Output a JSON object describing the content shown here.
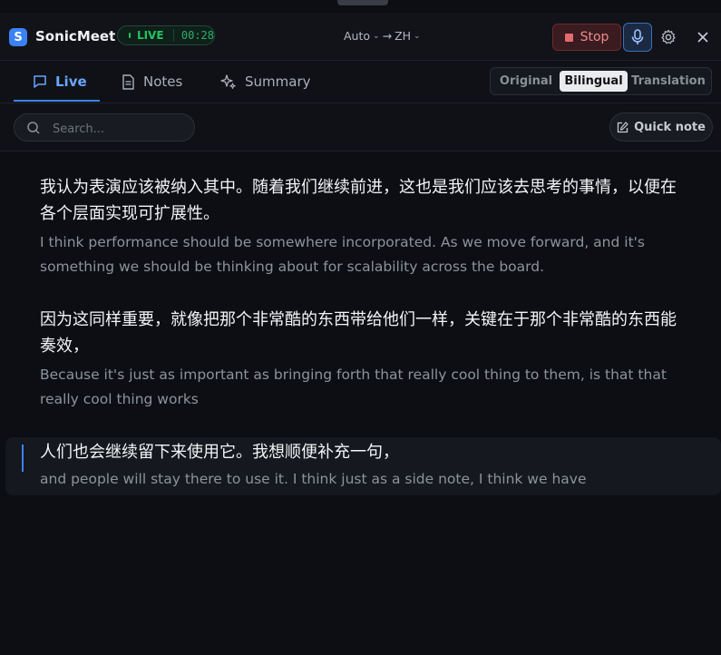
{
  "app": {
    "name": "SonicMeet",
    "logo_letter": "S",
    "live_label": "LIVE",
    "elapsed": "00:28",
    "source_lang": "Auto",
    "arrow": "→",
    "target_lang": "ZH",
    "stop_label": "Stop"
  },
  "tabs": [
    {
      "label": "Live",
      "icon": "chat-bubble-icon",
      "active": true
    },
    {
      "label": "Notes",
      "icon": "document-icon",
      "active": false
    },
    {
      "label": "Summary",
      "icon": "sparkles-icon",
      "active": false
    }
  ],
  "view_modes": [
    {
      "label": "Original",
      "active": false
    },
    {
      "label": "Bilingual",
      "active": true
    },
    {
      "label": "Translation",
      "active": false
    }
  ],
  "search": {
    "placeholder": "Search..."
  },
  "quick_note_label": "Quick note",
  "transcript": [
    {
      "zh": "我认为表演应该被纳入其中。随着我们继续前进，这也是我们应该去思考的事情，以便在各个层面实现可扩展性。",
      "en": "I think performance should be somewhere incorporated. As we move forward, and it's something we should be thinking about for scalability across the board."
    },
    {
      "zh": "因为这同样重要，就像把那个非常酷的东西带给他们一样，关键在于那个非常酷的东西能奏效，",
      "en": "Because it's just as important as bringing forth that really cool thing to them, is that that really cool thing works"
    },
    {
      "zh": "人们也会继续留下来使用它。我想顺便补充一句，",
      "en": "and people will stay there to use it. I think just as a side note, I think we have",
      "current": true
    }
  ],
  "colors": {
    "accent": "#3b82f6",
    "live": "#22c55e",
    "stop": "#e06b70"
  }
}
